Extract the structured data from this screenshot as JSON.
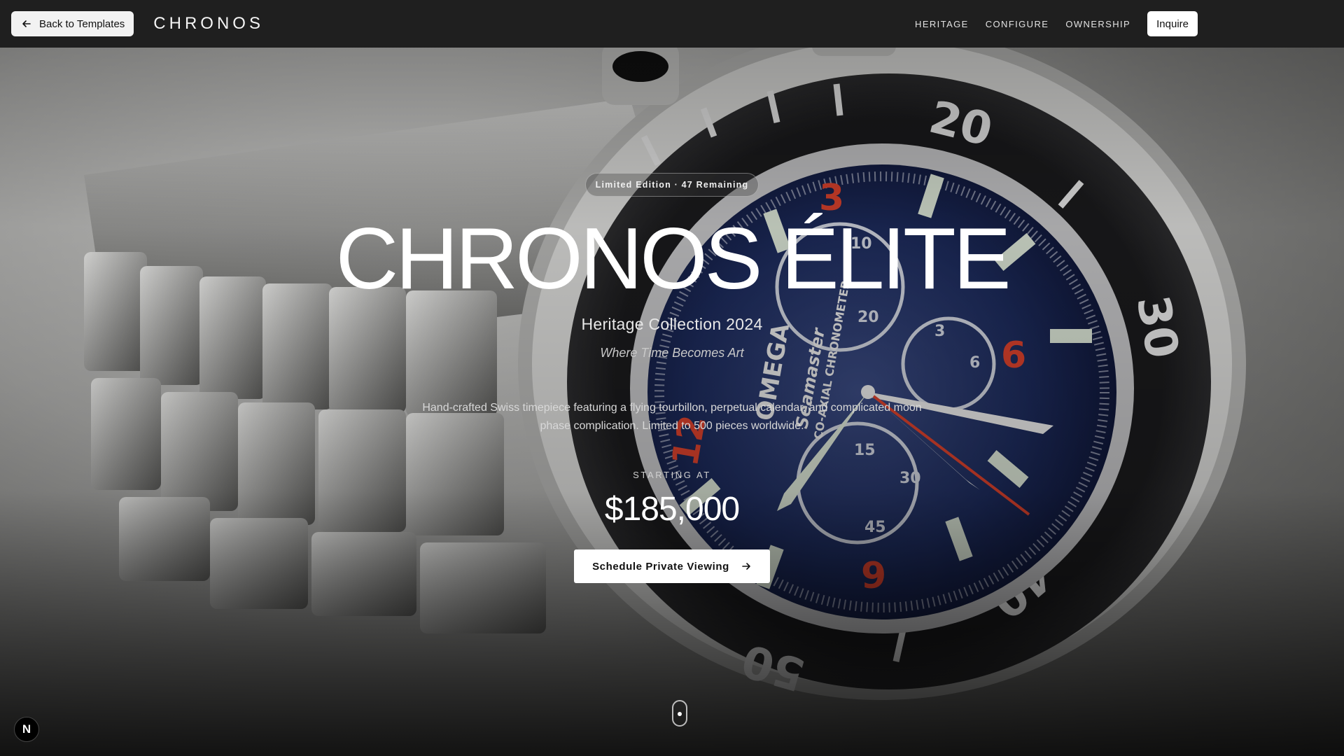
{
  "navbar": {
    "back_label": "Back to Templates",
    "brand": "CHRONOS",
    "links": [
      "HERITAGE",
      "CONFIGURE",
      "OWNERSHIP"
    ],
    "inquire_label": "Inquire"
  },
  "hero": {
    "badge": "Limited Edition · 47 Remaining",
    "title": "CHRONOS ÉLITE",
    "subtitle": "Heritage Collection 2024",
    "tagline": "Where Time Becomes Art",
    "description": "Hand-crafted Swiss timepiece featuring a flying tourbillon, perpetual calendar, and complicated moon phase complication. Limited to 500 pieces worldwide.",
    "price_label": "STARTING AT",
    "price": "$185,000",
    "cta_label": "Schedule Private Viewing"
  },
  "dev_badge": "N",
  "colors": {
    "navbar_bg": "#1f1f1f",
    "dial_blue": "#1c2a5a",
    "accent_red": "#d8412c"
  },
  "icons": {
    "back": "arrow-left-icon",
    "cta": "arrow-right-icon",
    "scroll": "scroll-mouse-icon"
  }
}
